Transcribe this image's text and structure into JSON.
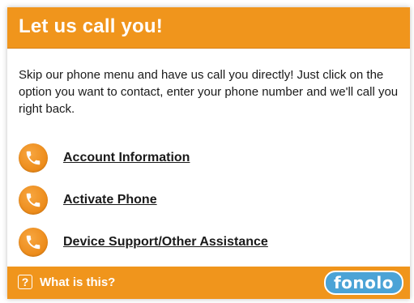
{
  "header": {
    "title": "Let us call you!"
  },
  "intro": {
    "text": "Skip our phone menu and have us call you directly! Just click on the option you want to contact, enter your phone number and we'll call you right back."
  },
  "options": [
    {
      "label": "Account Information",
      "icon": "phone-icon"
    },
    {
      "label": "Activate Phone",
      "icon": "phone-icon"
    },
    {
      "label": "Device Support/Other Assistance",
      "icon": "phone-icon"
    }
  ],
  "footer": {
    "help_icon": "?",
    "help_text": "What is this?",
    "brand": "fonolo"
  },
  "colors": {
    "accent": "#f0951c",
    "brand_blue": "#4ba3d6",
    "text": "#1a1a1a"
  }
}
